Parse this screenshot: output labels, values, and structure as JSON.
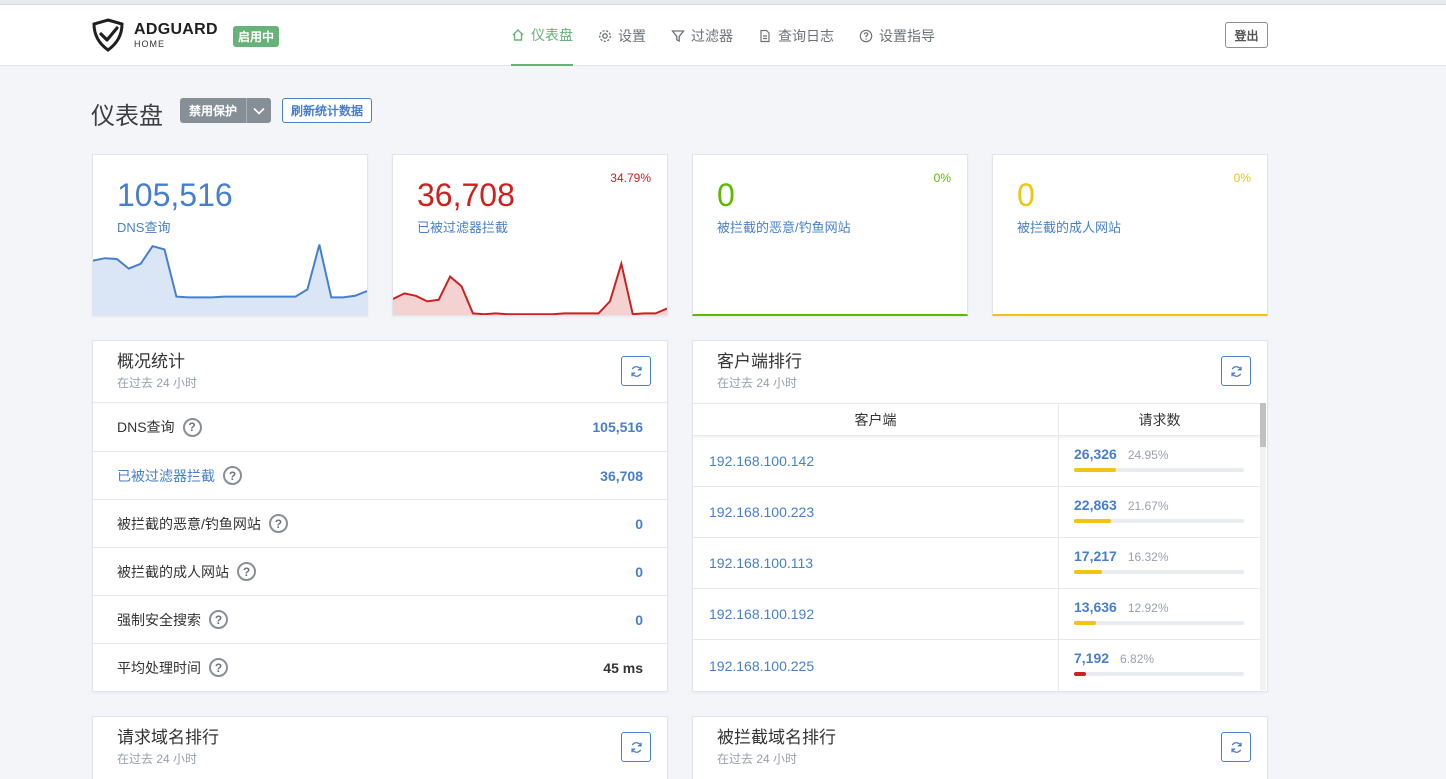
{
  "header": {
    "logo_main": "ADGUARD",
    "logo_sub": "HOME",
    "status": "启用中",
    "nav": [
      {
        "label": "仪表盘",
        "icon": "home-icon",
        "active": true
      },
      {
        "label": "设置",
        "icon": "gear-icon"
      },
      {
        "label": "过滤器",
        "icon": "filter-icon"
      },
      {
        "label": "查询日志",
        "icon": "document-icon"
      },
      {
        "label": "设置指导",
        "icon": "help-circle-icon"
      }
    ],
    "logout": "登出"
  },
  "page": {
    "title": "仪表盘",
    "protect_button": "禁用保护",
    "refresh_button": "刷新统计数据"
  },
  "stats": [
    {
      "value": "105,516",
      "label": "DNS查询",
      "pct": "",
      "color": "#467fcf"
    },
    {
      "value": "36,708",
      "label": "已被过滤器拦截",
      "pct": "34.79%",
      "color": "#cd201f"
    },
    {
      "value": "0",
      "label": "被拦截的恶意/钓鱼网站",
      "pct": "0%",
      "color": "#5eba00"
    },
    {
      "value": "0",
      "label": "被拦截的成人网站",
      "pct": "0%",
      "color": "#f1c40f"
    }
  ],
  "spark": {
    "dns": [
      68,
      71,
      70,
      58,
      64,
      86,
      82,
      23,
      22,
      22,
      22,
      23,
      23,
      23,
      23,
      23,
      23,
      23,
      32,
      88,
      22,
      22,
      24,
      30
    ],
    "blocked": [
      20,
      27,
      24,
      17,
      19,
      48,
      36,
      2,
      1,
      2,
      1,
      1,
      1,
      1,
      1,
      2,
      2,
      2,
      2,
      17,
      64,
      1,
      2,
      2,
      8
    ]
  },
  "general": {
    "title": "概况统计",
    "subtitle": "在过去 24 小时",
    "rows": [
      {
        "label": "DNS查询",
        "value": "105,516",
        "link": false
      },
      {
        "label": "已被过滤器拦截",
        "value": "36,708",
        "link": true
      },
      {
        "label": "被拦截的恶意/钓鱼网站",
        "value": "0",
        "link": false
      },
      {
        "label": "被拦截的成人网站",
        "value": "0",
        "link": false
      },
      {
        "label": "强制安全搜索",
        "value": "0",
        "link": false
      },
      {
        "label": "平均处理时间",
        "value": "45 ms",
        "link": false
      }
    ]
  },
  "clients": {
    "title": "客户端排行",
    "subtitle": "在过去 24 小时",
    "col_client": "客户端",
    "col_requests": "请求数",
    "rows": [
      {
        "ip": "192.168.100.142",
        "count": "26,326",
        "pct": "24.95%",
        "fill": 24.95,
        "color": "#f1c40f"
      },
      {
        "ip": "192.168.100.223",
        "count": "22,863",
        "pct": "21.67%",
        "fill": 21.67,
        "color": "#f1c40f"
      },
      {
        "ip": "192.168.100.113",
        "count": "17,217",
        "pct": "16.32%",
        "fill": 16.32,
        "color": "#f1c40f"
      },
      {
        "ip": "192.168.100.192",
        "count": "13,636",
        "pct": "12.92%",
        "fill": 12.92,
        "color": "#f1c40f"
      },
      {
        "ip": "192.168.100.225",
        "count": "7,192",
        "pct": "6.82%",
        "fill": 6.82,
        "color": "#cd201f"
      }
    ]
  },
  "domains": {
    "title": "请求域名排行",
    "subtitle": "在过去 24 小时"
  },
  "blocked_domains": {
    "title": "被拦截域名排行",
    "subtitle": "在过去 24 小时"
  }
}
